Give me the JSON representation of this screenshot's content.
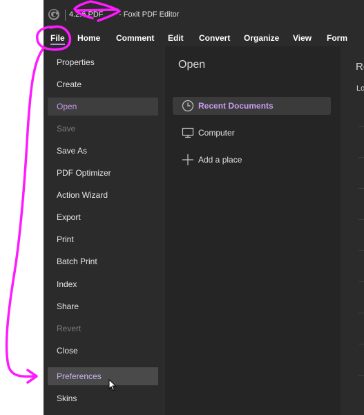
{
  "window": {
    "title_file": "4.2.6 PDF",
    "title_app": "- Foxit PDF Editor"
  },
  "menu": [
    "File",
    "Home",
    "Comment",
    "Edit",
    "Convert",
    "Organize",
    "View",
    "Form"
  ],
  "left_menu": {
    "items": [
      {
        "label": "Properties",
        "state": "normal"
      },
      {
        "label": "Create",
        "state": "normal"
      },
      {
        "label": "Open",
        "state": "selected"
      },
      {
        "label": "Save",
        "state": "disabled"
      },
      {
        "label": "Save As",
        "state": "normal"
      },
      {
        "label": "PDF Optimizer",
        "state": "normal"
      },
      {
        "label": "Action Wizard",
        "state": "normal"
      },
      {
        "label": "Export",
        "state": "normal"
      },
      {
        "label": "Print",
        "state": "normal"
      },
      {
        "label": "Batch Print",
        "state": "normal"
      },
      {
        "label": "Index",
        "state": "normal"
      },
      {
        "label": "Share",
        "state": "normal"
      },
      {
        "label": "Revert",
        "state": "disabled"
      },
      {
        "label": "Close",
        "state": "normal"
      },
      {
        "label": "Preferences",
        "state": "hovered"
      },
      {
        "label": "Skins",
        "state": "normal"
      }
    ]
  },
  "open_panel": {
    "title": "Open",
    "items": [
      {
        "label": "Recent Documents",
        "icon": "clock-icon"
      },
      {
        "label": "Computer",
        "icon": "monitor-icon"
      },
      {
        "label": "Add a place",
        "icon": "plus-icon"
      }
    ]
  },
  "right_panel": {
    "title": "Re",
    "subtitle": "Lo"
  },
  "colors": {
    "accent": "#c89cf2",
    "annotation": "#ff1aff",
    "background": "#2b2b2b"
  }
}
